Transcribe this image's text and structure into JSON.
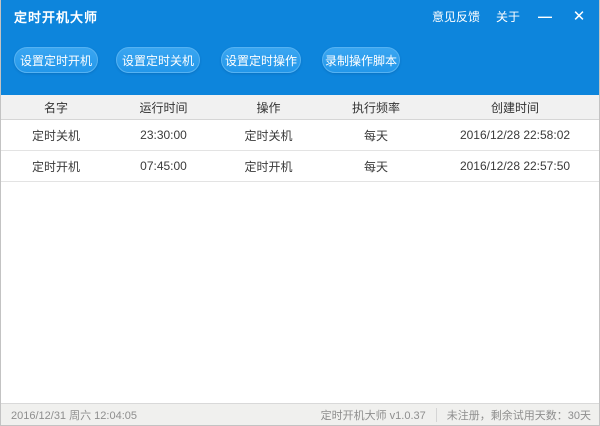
{
  "window": {
    "title": "定时开机大师"
  },
  "titlebar": {
    "feedback_label": "意见反馈",
    "about_label": "关于",
    "minimize_icon": "—",
    "close_icon": "✕"
  },
  "toolbar": {
    "buttons": {
      "set_power_on": "设置定时开机",
      "set_power_off": "设置定时关机",
      "set_operation": "设置定时操作",
      "record_script": "录制操作脚本"
    }
  },
  "table": {
    "columns": {
      "name": "名字",
      "run_time": "运行时间",
      "operation": "操作",
      "frequency": "执行频率",
      "created": "创建时间"
    },
    "rows": [
      {
        "name": "定时关机",
        "run_time": "23:30:00",
        "operation": "定时关机",
        "frequency": "每天",
        "created": "2016/12/28 22:58:02"
      },
      {
        "name": "定时开机",
        "run_time": "07:45:00",
        "operation": "定时开机",
        "frequency": "每天",
        "created": "2016/12/28 22:57:50"
      }
    ]
  },
  "statusbar": {
    "datetime": "2016/12/31 周六 12:04:05",
    "app_version": "定时开机大师 v1.0.37",
    "registration": "未注册，剩余试用天数：30天"
  },
  "colors": {
    "accent_blue": "#0d85dc",
    "button_blue": "#2f9ff0",
    "header_gray": "#f1f1f1",
    "status_gray": "#f0f0ee"
  }
}
